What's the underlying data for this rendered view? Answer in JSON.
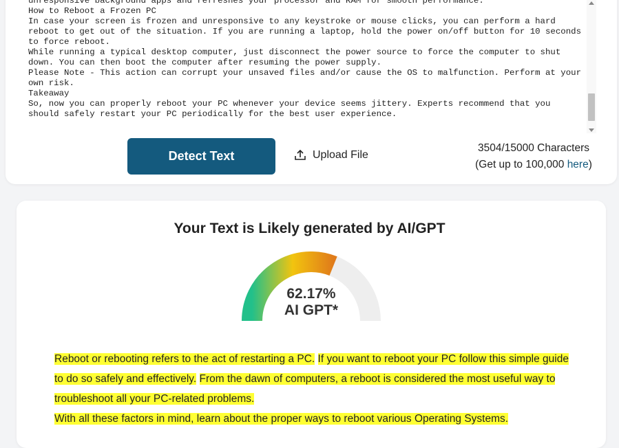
{
  "input": {
    "lines": [
      "unresponsive background apps and refreshes your processor and RAM for smooth performance.",
      "How to Reboot a Frozen PC",
      "In case your screen is frozen and unresponsive to any keystroke or mouse clicks, you can perform a hard reboot to get out of the situation. If you are running a laptop, hold the power on/off button for 10 seconds to force reboot.",
      "While running a typical desktop computer, just disconnect the power source to force the computer to shut down. You can then boot the computer after resuming the power supply.",
      "Please Note - This action can corrupt your unsaved files and/or cause the OS to malfunction. Perform at your own risk.",
      "Takeaway",
      "So, now you can properly reboot your PC whenever your device seems jittery. Experts recommend that you should safely restart your PC periodically for the best user experience."
    ]
  },
  "actions": {
    "detect_label": "Detect Text",
    "upload_label": "Upload File"
  },
  "counter": {
    "count_text": "3504/15000 Characters",
    "upgrade_prefix": "(Get up to 100,000 ",
    "upgrade_link": "here",
    "upgrade_suffix": ")"
  },
  "result": {
    "title": "Your Text is Likely generated by AI/GPT",
    "percent_text": "62.17%",
    "percent_value": 62.17,
    "gauge_label": "AI GPT*",
    "colors": {
      "gauge_start": "#22c08a",
      "gauge_mid": "#f2c40f",
      "gauge_end": "#e07b1a",
      "gauge_track": "#eeeeee",
      "highlight": "#ffff33"
    },
    "segments": [
      {
        "text": "Reboot or rebooting refers to the act of restarting a PC.",
        "highlighted": true
      },
      {
        "text": " ",
        "highlighted": false
      },
      {
        "text": "If you want to reboot your PC follow this simple guide to do so safely and effectively.",
        "highlighted": true
      },
      {
        "text": "  ",
        "highlighted": false
      },
      {
        "text": "From the dawn of computers, a reboot is considered the most useful way to troubleshoot all your PC-related problems.",
        "highlighted": true
      },
      {
        "text": "\n",
        "highlighted": false
      },
      {
        "text": "With all these factors in mind, learn about the proper ways to reboot various Operating Systems.",
        "highlighted": true
      }
    ]
  }
}
